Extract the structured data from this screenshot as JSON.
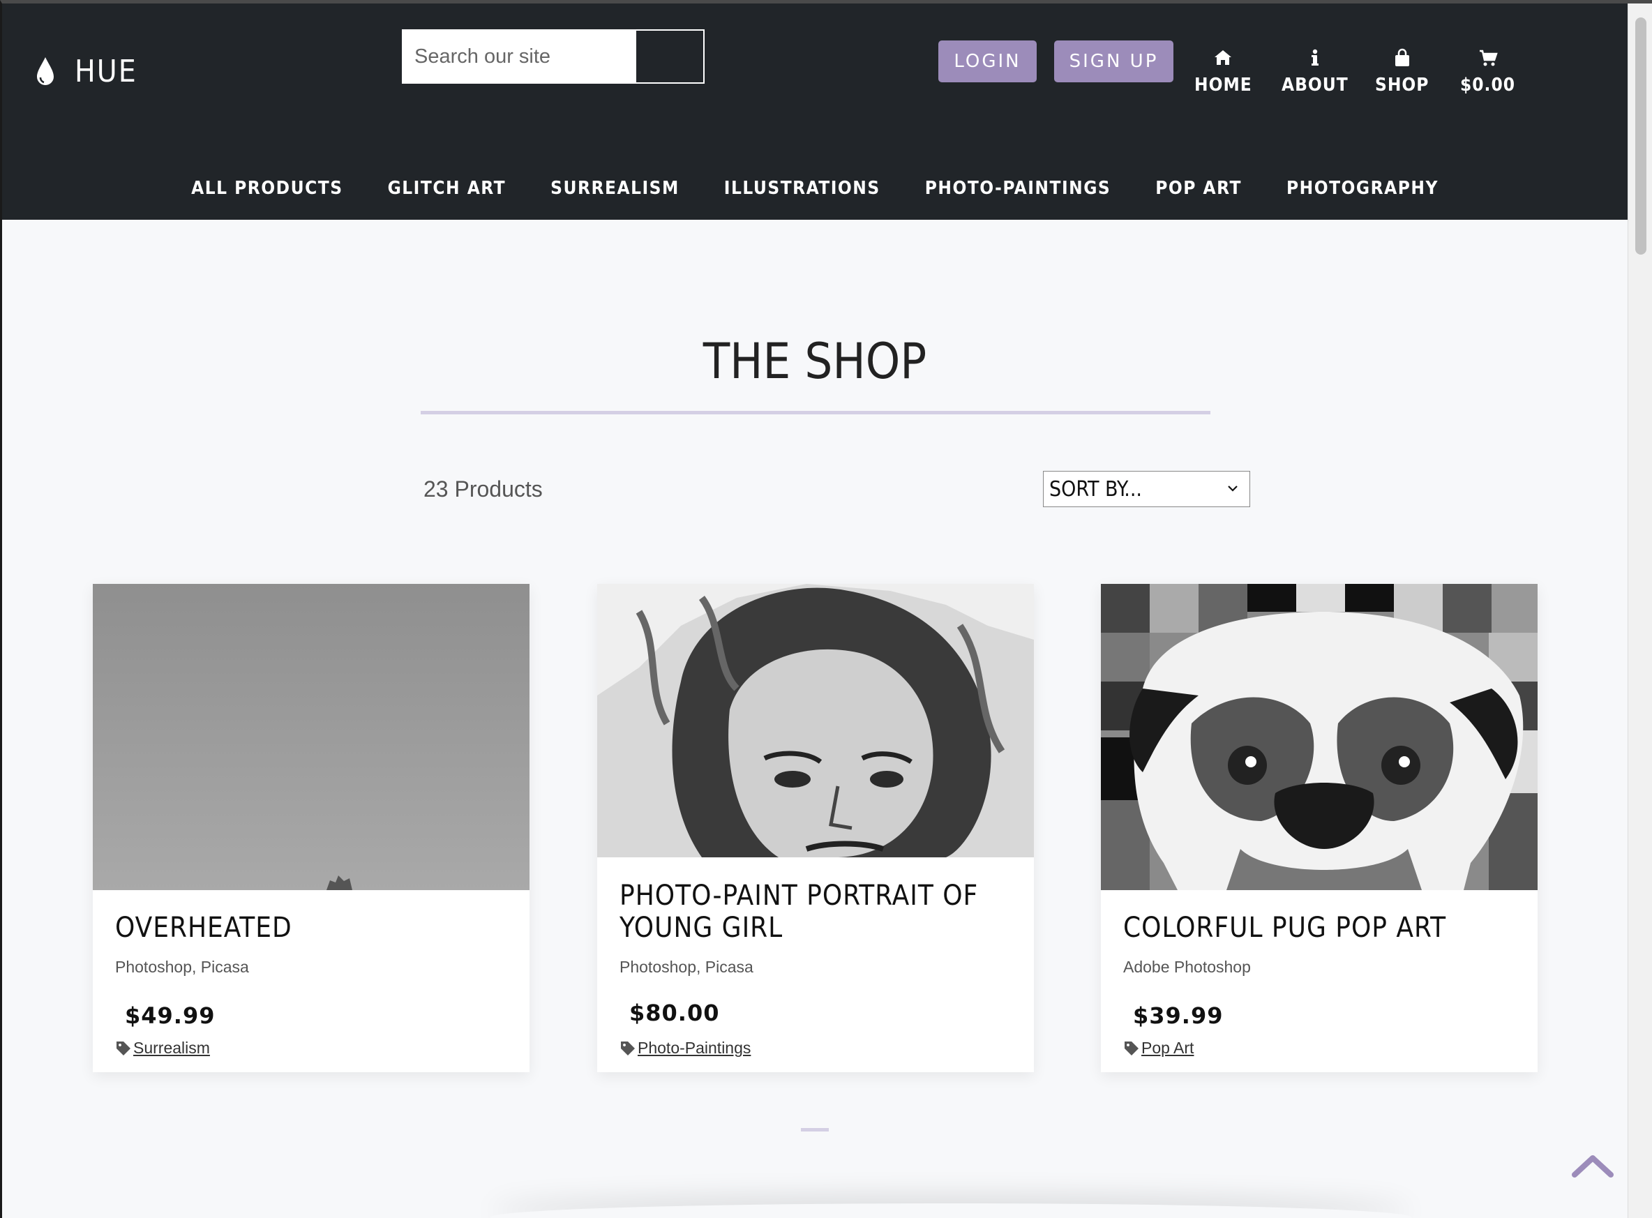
{
  "brand": {
    "name": "HUE"
  },
  "search": {
    "placeholder": "Search our site"
  },
  "auth": {
    "login_label": "LOGIN",
    "signup_label": "SIGN UP"
  },
  "topnav": {
    "home": "HOME",
    "about": "ABOUT",
    "shop": "SHOP",
    "cart": "$0.00"
  },
  "categories": [
    "ALL PRODUCTS",
    "GLITCH ART",
    "SURREALISM",
    "ILLUSTRATIONS",
    "PHOTO-PAINTINGS",
    "POP ART",
    "PHOTOGRAPHY"
  ],
  "shop": {
    "title": "THE SHOP",
    "count": "23 Products",
    "sort_label": "SORT BY..."
  },
  "products": [
    {
      "title": "OVERHEATED",
      "tools": "Photoshop, Picasa",
      "price": "$49.99",
      "tag": "Surrealism"
    },
    {
      "title": "PHOTO-PAINT PORTRAIT OF YOUNG GIRL",
      "tools": "Photoshop, Picasa",
      "price": "$80.00",
      "tag": "Photo-Paintings"
    },
    {
      "title": "COLORFUL PUG POP ART",
      "tools": "Adobe Photoshop",
      "price": "$39.99",
      "tag": "Pop Art"
    }
  ],
  "colors": {
    "header": "#212529",
    "accent": "#9c8cba",
    "background": "#f7f8fa"
  }
}
